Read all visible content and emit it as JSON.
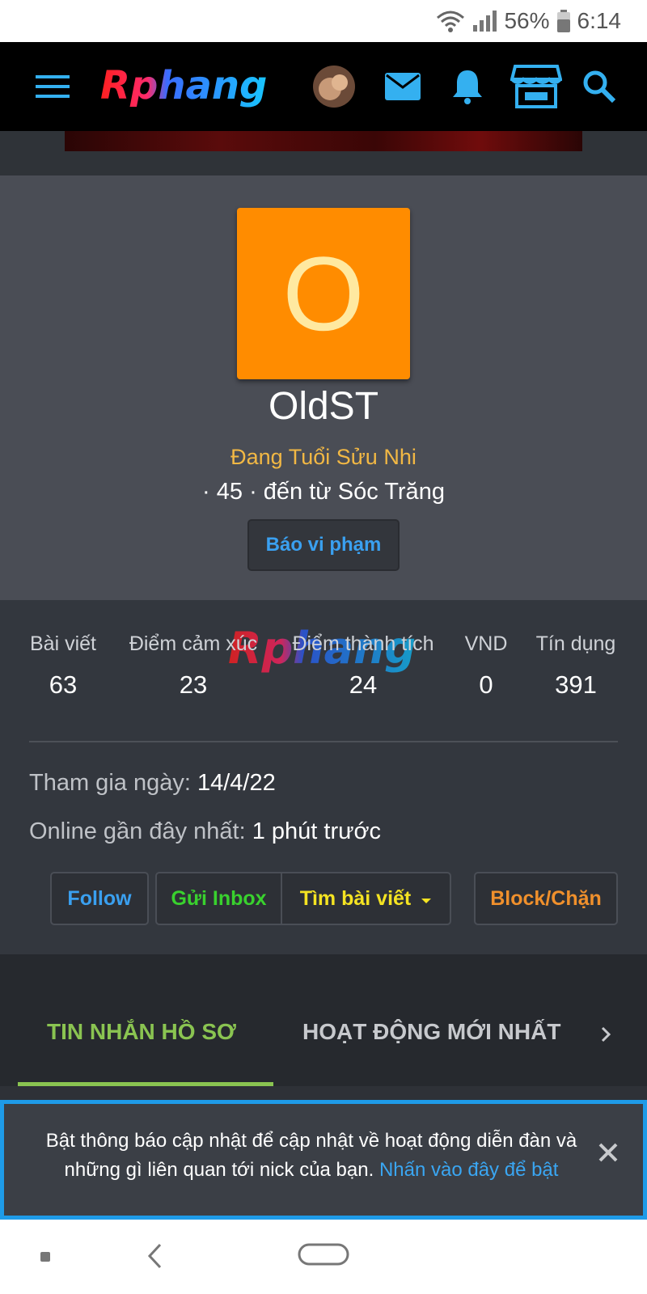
{
  "status_bar": {
    "battery": "56%",
    "time": "6:14",
    "icons": [
      "wifi-icon",
      "signal-icon",
      "battery-icon"
    ]
  },
  "navbar": {
    "logo_text": "Rphang",
    "icons": [
      "menu-icon",
      "avatar-icon",
      "mail-icon",
      "bell-icon",
      "store-icon",
      "search-icon"
    ]
  },
  "profile": {
    "avatar_letter": "O",
    "username": "OldST",
    "user_title": "Đang Tuổi Sửu Nhi",
    "user_info": "· 45 · đến từ Sóc Trăng",
    "report_label": "Báo vi phạm"
  },
  "stats": {
    "watermark_text": "Rphang",
    "items": [
      {
        "label": "Bài viết",
        "value": "63"
      },
      {
        "label": "Điểm cảm xúc",
        "value": "23"
      },
      {
        "label": "Điểm thành tích",
        "value": "24"
      },
      {
        "label": "VND",
        "value": "0"
      },
      {
        "label": "Tín dụng",
        "value": "391"
      }
    ],
    "joined_label": "Tham gia ngày:",
    "joined_value": "14/4/22",
    "online_label": "Online gần đây nhất:",
    "online_value": "1 phút trước"
  },
  "actions": {
    "follow": "Follow",
    "inbox": "Gửi Inbox",
    "find_posts": "Tìm bài viết",
    "block": "Block/Chặn"
  },
  "tabs": {
    "items": [
      "TIN NHẮN HỒ SƠ",
      "HOẠT ĐỘNG MỚI NHẤT"
    ],
    "active_index": 0
  },
  "notice": {
    "text": "Bật thông báo cập nhật để cập nhật về hoạt động diễn đàn và những gì liên quan tới nick của bạn.",
    "link": "Nhấn vào đây để bật"
  },
  "colors": {
    "accent_blue": "#3aa0f0",
    "avatar_orange": "#ff8c00",
    "title_gold": "#f2b844",
    "tab_active_green": "#8ac451",
    "inbox_green": "#39d12e",
    "find_yellow": "#f4e322",
    "block_orange": "#f0902c"
  }
}
